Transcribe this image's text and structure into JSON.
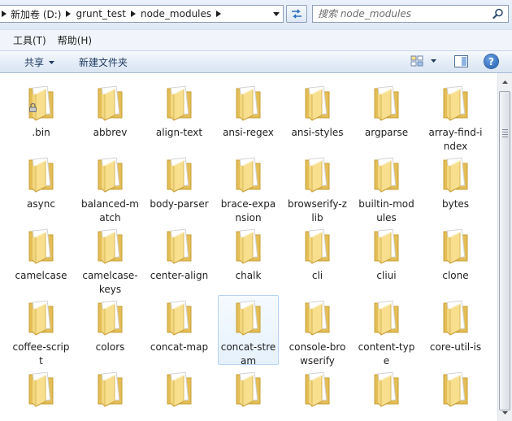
{
  "address": {
    "crumbs": [
      "新加卷 (D:)",
      "grunt_test",
      "node_modules"
    ]
  },
  "search": {
    "placeholder": "搜索 node_modules"
  },
  "menu": [
    {
      "label": "工具(T)",
      "name": "menu-tools"
    },
    {
      "label": "帮助(H)",
      "name": "menu-help"
    }
  ],
  "toolbar": {
    "share_label": "共享",
    "new_folder_label": "新建文件夹",
    "help_label": "?"
  },
  "folders": [
    {
      "name": ".bin",
      "locked": true
    },
    {
      "name": "abbrev"
    },
    {
      "name": "align-text"
    },
    {
      "name": "ansi-regex"
    },
    {
      "name": "ansi-styles"
    },
    {
      "name": "argparse"
    },
    {
      "name": "array-find-index"
    },
    {
      "name": "async"
    },
    {
      "name": "balanced-match"
    },
    {
      "name": "body-parser"
    },
    {
      "name": "brace-expansion"
    },
    {
      "name": "browserify-zlib"
    },
    {
      "name": "builtin-modules"
    },
    {
      "name": "bytes"
    },
    {
      "name": "camelcase"
    },
    {
      "name": "camelcase-keys"
    },
    {
      "name": "center-align"
    },
    {
      "name": "chalk"
    },
    {
      "name": "cli"
    },
    {
      "name": "cliui"
    },
    {
      "name": "clone"
    },
    {
      "name": "coffee-script"
    },
    {
      "name": "colors"
    },
    {
      "name": "concat-map"
    },
    {
      "name": "concat-stream",
      "hover": true
    },
    {
      "name": "console-browserify"
    },
    {
      "name": "content-type"
    },
    {
      "name": "core-util-is"
    },
    {
      "name": ""
    },
    {
      "name": ""
    },
    {
      "name": ""
    },
    {
      "name": ""
    },
    {
      "name": ""
    },
    {
      "name": ""
    },
    {
      "name": ""
    }
  ],
  "colors": {
    "folder_back": "#e6c35f",
    "folder_front": "#f7df8e",
    "selection_border": "#b6d3f1"
  }
}
